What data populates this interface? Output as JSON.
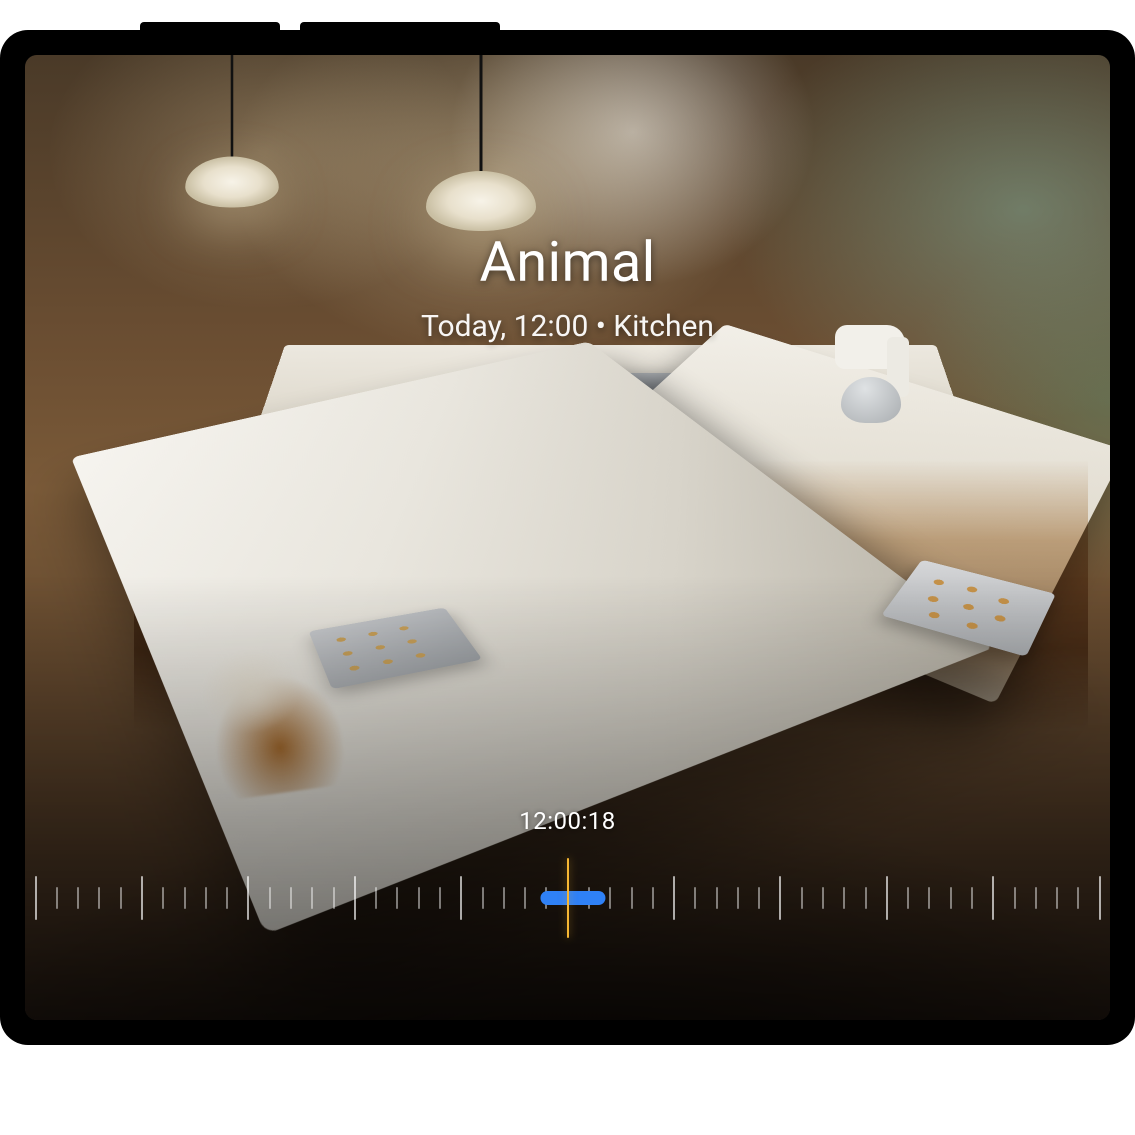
{
  "event": {
    "title": "Animal",
    "subtitle": "Today, 12:00 • Kitchen",
    "day_label": "Today",
    "time_label": "12:00",
    "room": "Kitchen"
  },
  "timeline": {
    "playhead_time": "12:00:18",
    "playhead_percent": 50,
    "tick_count": 51,
    "major_every": 5,
    "event_clip": {
      "start_percent": 47.5,
      "width_percent": 6,
      "color": "#2f81f6"
    },
    "colors": {
      "playhead": "#f7b733",
      "tick": "rgba(255,255,255,0.45)",
      "tick_major": "rgba(255,255,255,0.65)"
    }
  },
  "icons": {
    "pendant_lamp": "pendant-lamp-icon",
    "dog": "dog-icon",
    "mixer": "stand-mixer-icon",
    "range": "stove-icon"
  }
}
